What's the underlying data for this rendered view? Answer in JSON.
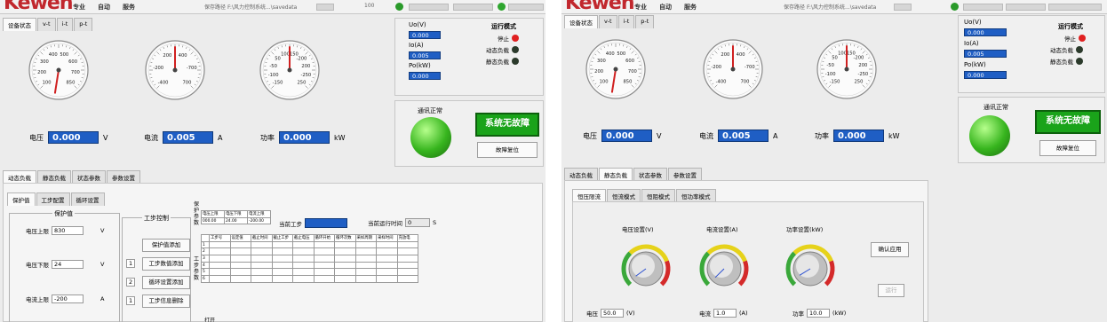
{
  "header": {
    "logo": "Kewen",
    "menus": [
      "专业",
      "自动",
      "服务"
    ],
    "path_label": "保存路径",
    "path_value": "F:\\风力控制系统...\\savedata",
    "num_value": "100"
  },
  "top_tabs": [
    "设备状态",
    "v-t",
    "i-t",
    "p-t"
  ],
  "gauges": [
    {
      "name": "voltage",
      "ticks": [
        "100",
        "200",
        "300",
        "400",
        "500",
        "600",
        "700",
        "850"
      ],
      "min": 100,
      "max": 850,
      "value": 0
    },
    {
      "name": "current",
      "ticks": [
        "-400",
        "-200",
        "200",
        "400",
        "-700",
        "700"
      ],
      "min": -700,
      "max": 700,
      "value": 0
    },
    {
      "name": "power",
      "ticks": [
        "-150",
        "-100",
        "-50",
        "50",
        "100",
        "150",
        "-200",
        "200",
        "-250",
        "250"
      ],
      "min": -250,
      "max": 250,
      "value": 0
    }
  ],
  "readings": {
    "voltage": {
      "label": "电压",
      "value": "0.000",
      "unit": "V"
    },
    "current": {
      "label": "电流",
      "value": "0.005",
      "unit": "A"
    },
    "power": {
      "label": "功率",
      "value": "0.000",
      "unit": "kW"
    }
  },
  "side": {
    "uo_label": "Uo(V)",
    "uo_value": "0.000",
    "io_label": "Io(A)",
    "io_value": "0.005",
    "po_label": "Po(kW)",
    "po_value": "0.000",
    "mode_title": "运行模式",
    "modes": [
      {
        "label": "停止",
        "color": "#e02020"
      },
      {
        "label": "动态负载",
        "color": "#2b3a2b"
      },
      {
        "label": "静态负载",
        "color": "#2b3a2b"
      }
    ],
    "comm_label": "通讯正常",
    "fault_label": "系统无故障",
    "reset_label": "故障复位"
  },
  "left_lower": {
    "tabs": [
      "动态负载",
      "静态负载",
      "状态参数",
      "参数设置"
    ],
    "subtabs": [
      "保护值",
      "工步配置",
      "循环设置"
    ],
    "group_title": "保护值",
    "fields": [
      {
        "label": "电压上限",
        "value": "830",
        "unit": "V"
      },
      {
        "label": "电压下限",
        "value": "24",
        "unit": "V"
      },
      {
        "label": "电流上限",
        "value": "-200",
        "unit": "A"
      }
    ],
    "control_title": "工步控制",
    "buttons": [
      "保护值添加",
      "工步数值添加",
      "循环设置添加",
      "工步信息删除"
    ],
    "button_nums": [
      "1",
      "2",
      "1"
    ],
    "vertical_label": "保护参数",
    "vertical_label2": "工步参数",
    "prot_headers": [
      "电压上限",
      "电压下限",
      "电流上限"
    ],
    "prot_values": [
      "000.00",
      "24.00",
      "-200.00"
    ],
    "current_step_label": "当前工步",
    "run_time_label": "当前运行时间",
    "run_time_value": "0",
    "run_time_unit": "S",
    "table_headers": [
      "工步号",
      "设定值",
      "截止时间",
      "截止工步",
      "截止电压",
      "循环开始",
      "循环次数",
      "采样周期",
      "采样时间",
      "充放电"
    ],
    "table_rows": [
      "1",
      "2",
      "3",
      "4",
      "5",
      "6"
    ],
    "open_label": "打开"
  },
  "right_lower": {
    "tabs": [
      "动态负载",
      "静态负载",
      "状态参数",
      "参数设置"
    ],
    "subtabs": [
      "恒压限流",
      "恒流模式",
      "恒阻模式",
      "恒功率模式"
    ],
    "knobs": [
      {
        "label": "电压设置(V)",
        "ticks": [
          "24.0",
          "100.0",
          "200.0",
          "300.0",
          "400.0",
          "500.0",
          "600.0",
          "700.0",
          "800.0"
        ],
        "value": 50
      },
      {
        "label": "电流设置(A)",
        "ticks": [
          "0",
          "50",
          "100",
          "150",
          "200",
          "250",
          "300",
          "350",
          "400",
          "450",
          "500",
          "550",
          "667"
        ],
        "value": 1
      },
      {
        "label": "功率设置(kW)",
        "ticks": [
          "0",
          "20",
          "40",
          "60",
          "80",
          "100",
          "120",
          "140",
          "160",
          "180",
          "200"
        ],
        "value": 10
      }
    ],
    "confirm_label": "确认应用",
    "run_label": "运行",
    "bottom": [
      {
        "label": "电压",
        "value": "50.0",
        "unit": "(V)"
      },
      {
        "label": "电流",
        "value": "1.0",
        "unit": "(A)"
      },
      {
        "label": "功率",
        "value": "10.0",
        "unit": "(kW)"
      }
    ]
  }
}
